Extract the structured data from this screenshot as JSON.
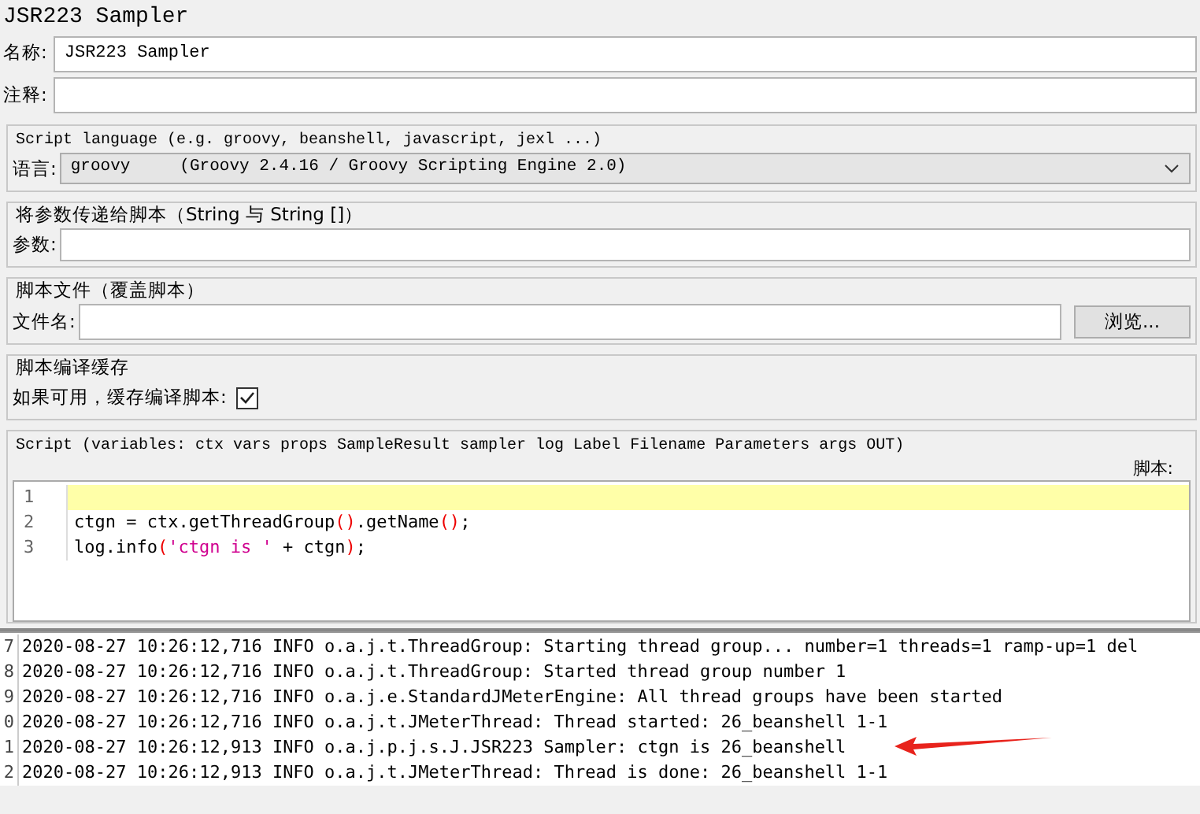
{
  "window": {
    "title": "JSR223 Sampler"
  },
  "name_field": {
    "label": "名称:",
    "value": "JSR223 Sampler"
  },
  "comment_field": {
    "label": "注释:"
  },
  "language_group": {
    "legend": "Script language (e.g. groovy, beanshell, javascript, jexl ...)",
    "label": "语言:",
    "value": "groovy     (Groovy 2.4.16 / Groovy Scripting Engine 2.0)"
  },
  "parameters_group": {
    "legend": "将参数传递给脚本（String 与 String []）",
    "label": "参数:"
  },
  "file_group": {
    "legend": "脚本文件（覆盖脚本）",
    "label": "文件名:",
    "button": "浏览..."
  },
  "cache_group": {
    "legend": "脚本编译缓存",
    "label": "如果可用，缓存编译脚本:",
    "checked": true
  },
  "script_group": {
    "legend": "Script (variables: ctx vars props SampleResult sampler log Label Filename Parameters args OUT)",
    "label": "脚本:",
    "lines": [
      {
        "number": "1",
        "selected": true
      },
      {
        "number": "2",
        "selected": false,
        "tokens": [
          {
            "kind": "plain",
            "text": "ctgn = ctx.getThreadGroup"
          },
          {
            "kind": "paren",
            "text": "()"
          },
          {
            "kind": "plain",
            "text": ".getName"
          },
          {
            "kind": "paren",
            "text": "()"
          },
          {
            "kind": "plain",
            "text": ";"
          }
        ]
      },
      {
        "number": "3",
        "selected": false,
        "tokens": [
          {
            "kind": "plain",
            "text": "log.info"
          },
          {
            "kind": "paren",
            "text": "("
          },
          {
            "kind": "string",
            "text": "'ctgn is '"
          },
          {
            "kind": "plain",
            "text": " + ctgn"
          },
          {
            "kind": "paren",
            "text": ")"
          },
          {
            "kind": "plain",
            "text": ";"
          }
        ]
      }
    ]
  },
  "log": [
    {
      "number": "7",
      "text": "2020-08-27 10:26:12,716 INFO o.a.j.t.ThreadGroup: Starting thread group... number=1 threads=1 ramp-up=1 del"
    },
    {
      "number": "8",
      "text": "2020-08-27 10:26:12,716 INFO o.a.j.t.ThreadGroup: Started thread group number 1"
    },
    {
      "number": "9",
      "text": "2020-08-27 10:26:12,716 INFO o.a.j.e.StandardJMeterEngine: All thread groups have been started"
    },
    {
      "number": "0",
      "text": "2020-08-27 10:26:12,716 INFO o.a.j.t.JMeterThread: Thread started: 26_beanshell 1-1"
    },
    {
      "number": "1",
      "text": "2020-08-27 10:26:12,913 INFO o.a.j.p.j.s.J.JSR223 Sampler: ctgn is 26_beanshell"
    },
    {
      "number": "2",
      "text": "2020-08-27 10:26:12,913 INFO o.a.j.t.JMeterThread: Thread is done: 26_beanshell 1-1"
    }
  ]
}
